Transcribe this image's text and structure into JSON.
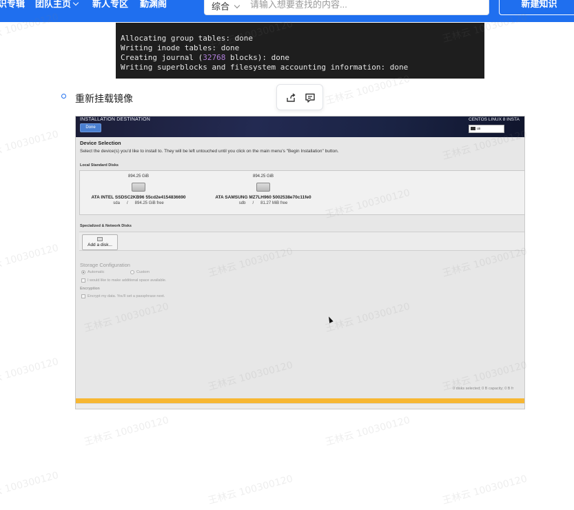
{
  "topnav": {
    "items": [
      {
        "label": "识专辑"
      },
      {
        "label": "团队主页"
      },
      {
        "label": "新人专区"
      },
      {
        "label": "勤渊阁"
      }
    ],
    "search": {
      "category": "综合",
      "placeholder": "请输入想要查找的内容..."
    },
    "new_button": "新建知识"
  },
  "terminal": {
    "lines": [
      {
        "pre": "Allocating group tables: done",
        "num": "",
        "post": ""
      },
      {
        "pre": "Writing inode tables: done",
        "num": "",
        "post": ""
      },
      {
        "pre": "Creating journal (",
        "num": "32768",
        "post": " blocks): done"
      },
      {
        "pre": "Writing superblocks and filesystem accounting information: done",
        "num": "",
        "post": ""
      }
    ]
  },
  "content": {
    "bullet_text": "重新挂载镜像"
  },
  "installer": {
    "title": "INSTALLATION DESTINATION",
    "done_label": "Done",
    "product": "CENTOS LINUX 8 INSTA",
    "keyboard": "us",
    "device_selection": "Device Selection",
    "device_instructions": "Select the device(s) you'd like to install to.  They will be left untouched until you click on the main menu's \"Begin Installation\" button.",
    "local_disks_label": "Local Standard Disks",
    "disks": [
      {
        "size": "894.25 GiB",
        "name": "ATA INTEL SSDSC2KB96 55cd2e4154836690",
        "dev": "sda",
        "sep": "/",
        "free": "894.25 GiB free"
      },
      {
        "size": "894.25 GiB",
        "name": "ATA SAMSUNG MZ7LH960 5002538e70c11fe0",
        "dev": "sdb",
        "sep": "/",
        "free": "81.27 MiB free"
      }
    ],
    "network_label": "Specialized & Network Disks",
    "add_disk": "Add a disk...",
    "storage_config": "Storage Configuration",
    "automatic": "Automatic",
    "custom": "Custom",
    "extra_space": "I would like to make additional space available.",
    "encryption": "Encryption",
    "encrypt_label": "Encrypt my data. You'll set a passphrase next.",
    "footer_status": "0 disks selected; 0 B capacity; 0 B fr"
  },
  "watermark": "王林云 100300120"
}
